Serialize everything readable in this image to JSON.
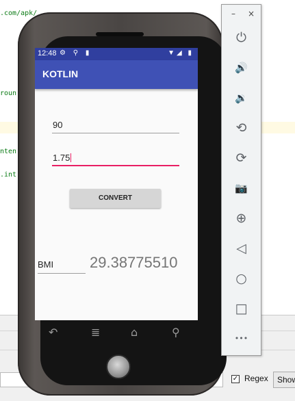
{
  "ide": {
    "code_fragments": [
      ".com/apk/",
      "roun",
      "nten",
      ".int"
    ],
    "search": {
      "regex_label": "Regex",
      "regex_checked": "✓",
      "show_label": "Show"
    }
  },
  "device": {
    "status_bar": {
      "time": "12:48",
      "left_icons": "⚙ ⚲ ▮",
      "right_icons": "▼◢ ▮"
    },
    "app_title": "KOTLIN",
    "weight_value": "90",
    "height_value": "1.75",
    "convert_label": "CONVERT",
    "bmi_label": "BMI",
    "bmi_value": "29.38775510",
    "nav": {
      "back": "↶",
      "menu": "≣",
      "home": "⌂",
      "search": "⚲"
    }
  },
  "toolbar": {
    "minimize": "–",
    "close": "×",
    "buttons": [
      {
        "icon": "power-icon",
        "glyph": "⏻"
      },
      {
        "icon": "volume-up-icon",
        "glyph": "🔊"
      },
      {
        "icon": "volume-down-icon",
        "glyph": "🔉"
      },
      {
        "icon": "rotate-left-icon",
        "glyph": "⟲"
      },
      {
        "icon": "rotate-right-icon",
        "glyph": "⟳"
      },
      {
        "icon": "camera-icon",
        "glyph": "📷"
      },
      {
        "icon": "zoom-icon",
        "glyph": "⊕"
      },
      {
        "icon": "back-icon",
        "glyph": "◁"
      },
      {
        "icon": "home-icon",
        "glyph": "○"
      },
      {
        "icon": "overview-icon",
        "glyph": "□"
      },
      {
        "icon": "more-icon",
        "glyph": "•••"
      }
    ]
  },
  "colors": {
    "app_bar": "#3f51b5",
    "status_bar": "#303f9f",
    "accent": "#e91e63"
  }
}
